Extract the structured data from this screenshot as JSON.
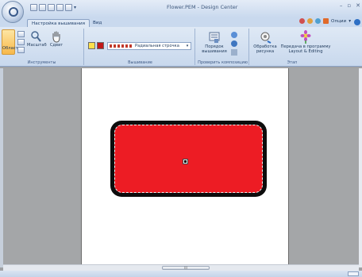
{
  "window": {
    "title": "Flower.PEM - Design Center"
  },
  "tabs": [
    {
      "label": "Настройка вышивания",
      "active": true
    },
    {
      "label": "Вид",
      "active": false
    }
  ],
  "options_label": "Опции",
  "ribbon": {
    "groups": [
      {
        "label": "Инструменты"
      },
      {
        "label": "Вышивание"
      },
      {
        "label": "Проверить композицию"
      },
      {
        "label": "Этап"
      }
    ],
    "tools": {
      "area_label": "Область",
      "zoom_label": "Масштаб",
      "pan_label": "Сдвиг"
    },
    "stitch_dropdown_value": "Радиальная строчка",
    "sequence_label_1": "Порядок",
    "sequence_label_2": "вышивания",
    "process_label_1": "Обработка",
    "process_label_2": "рисунка",
    "transfer_label_1": "Передача в программу",
    "transfer_label_2": "Layout & Editing"
  },
  "scrollbar": {
    "thumb_grip": "III"
  },
  "colors": {
    "fill": "#ed1c24",
    "outline": "#0d0d0d",
    "ribbon_bg": "#dfe9f5",
    "workspace_bg": "#a4a6a8"
  },
  "icons": [
    "orb-icon",
    "save-icon",
    "undo-icon",
    "redo-icon",
    "magnifier-icon",
    "hand-icon",
    "sequence-icon",
    "process-icon",
    "transfer-icon"
  ]
}
